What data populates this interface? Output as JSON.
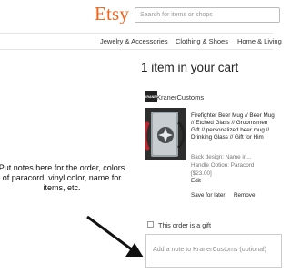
{
  "header": {
    "logo": "Etsy",
    "search_placeholder": "Search for items or shops",
    "categories": [
      "Jewelry & Accessories",
      "Clothing & Shoes",
      "Home & Living"
    ]
  },
  "cart": {
    "title": "1 item in your cart",
    "shop": {
      "name": "KranerCustoms",
      "logo_text": "KRANER"
    },
    "item": {
      "title": "Firefighter Beer Mug // Beer Mug // Etched Glass // Groomsmen Gift // personalized beer mug // Drinking Glass // Gift for Him",
      "details": [
        "Back design: Name in...",
        "Handle Option: Paracord",
        "[$23.00]"
      ],
      "edit": "Edit",
      "save_for_later": "Save for later",
      "remove": "Remove"
    },
    "gift_label": "This order is a gift",
    "note_placeholder": "Add a note to KranerCustoms (optional)"
  },
  "annotation": {
    "text": "Put notes here for the order, colors of paracord, vinyl color, name for items, etc."
  }
}
